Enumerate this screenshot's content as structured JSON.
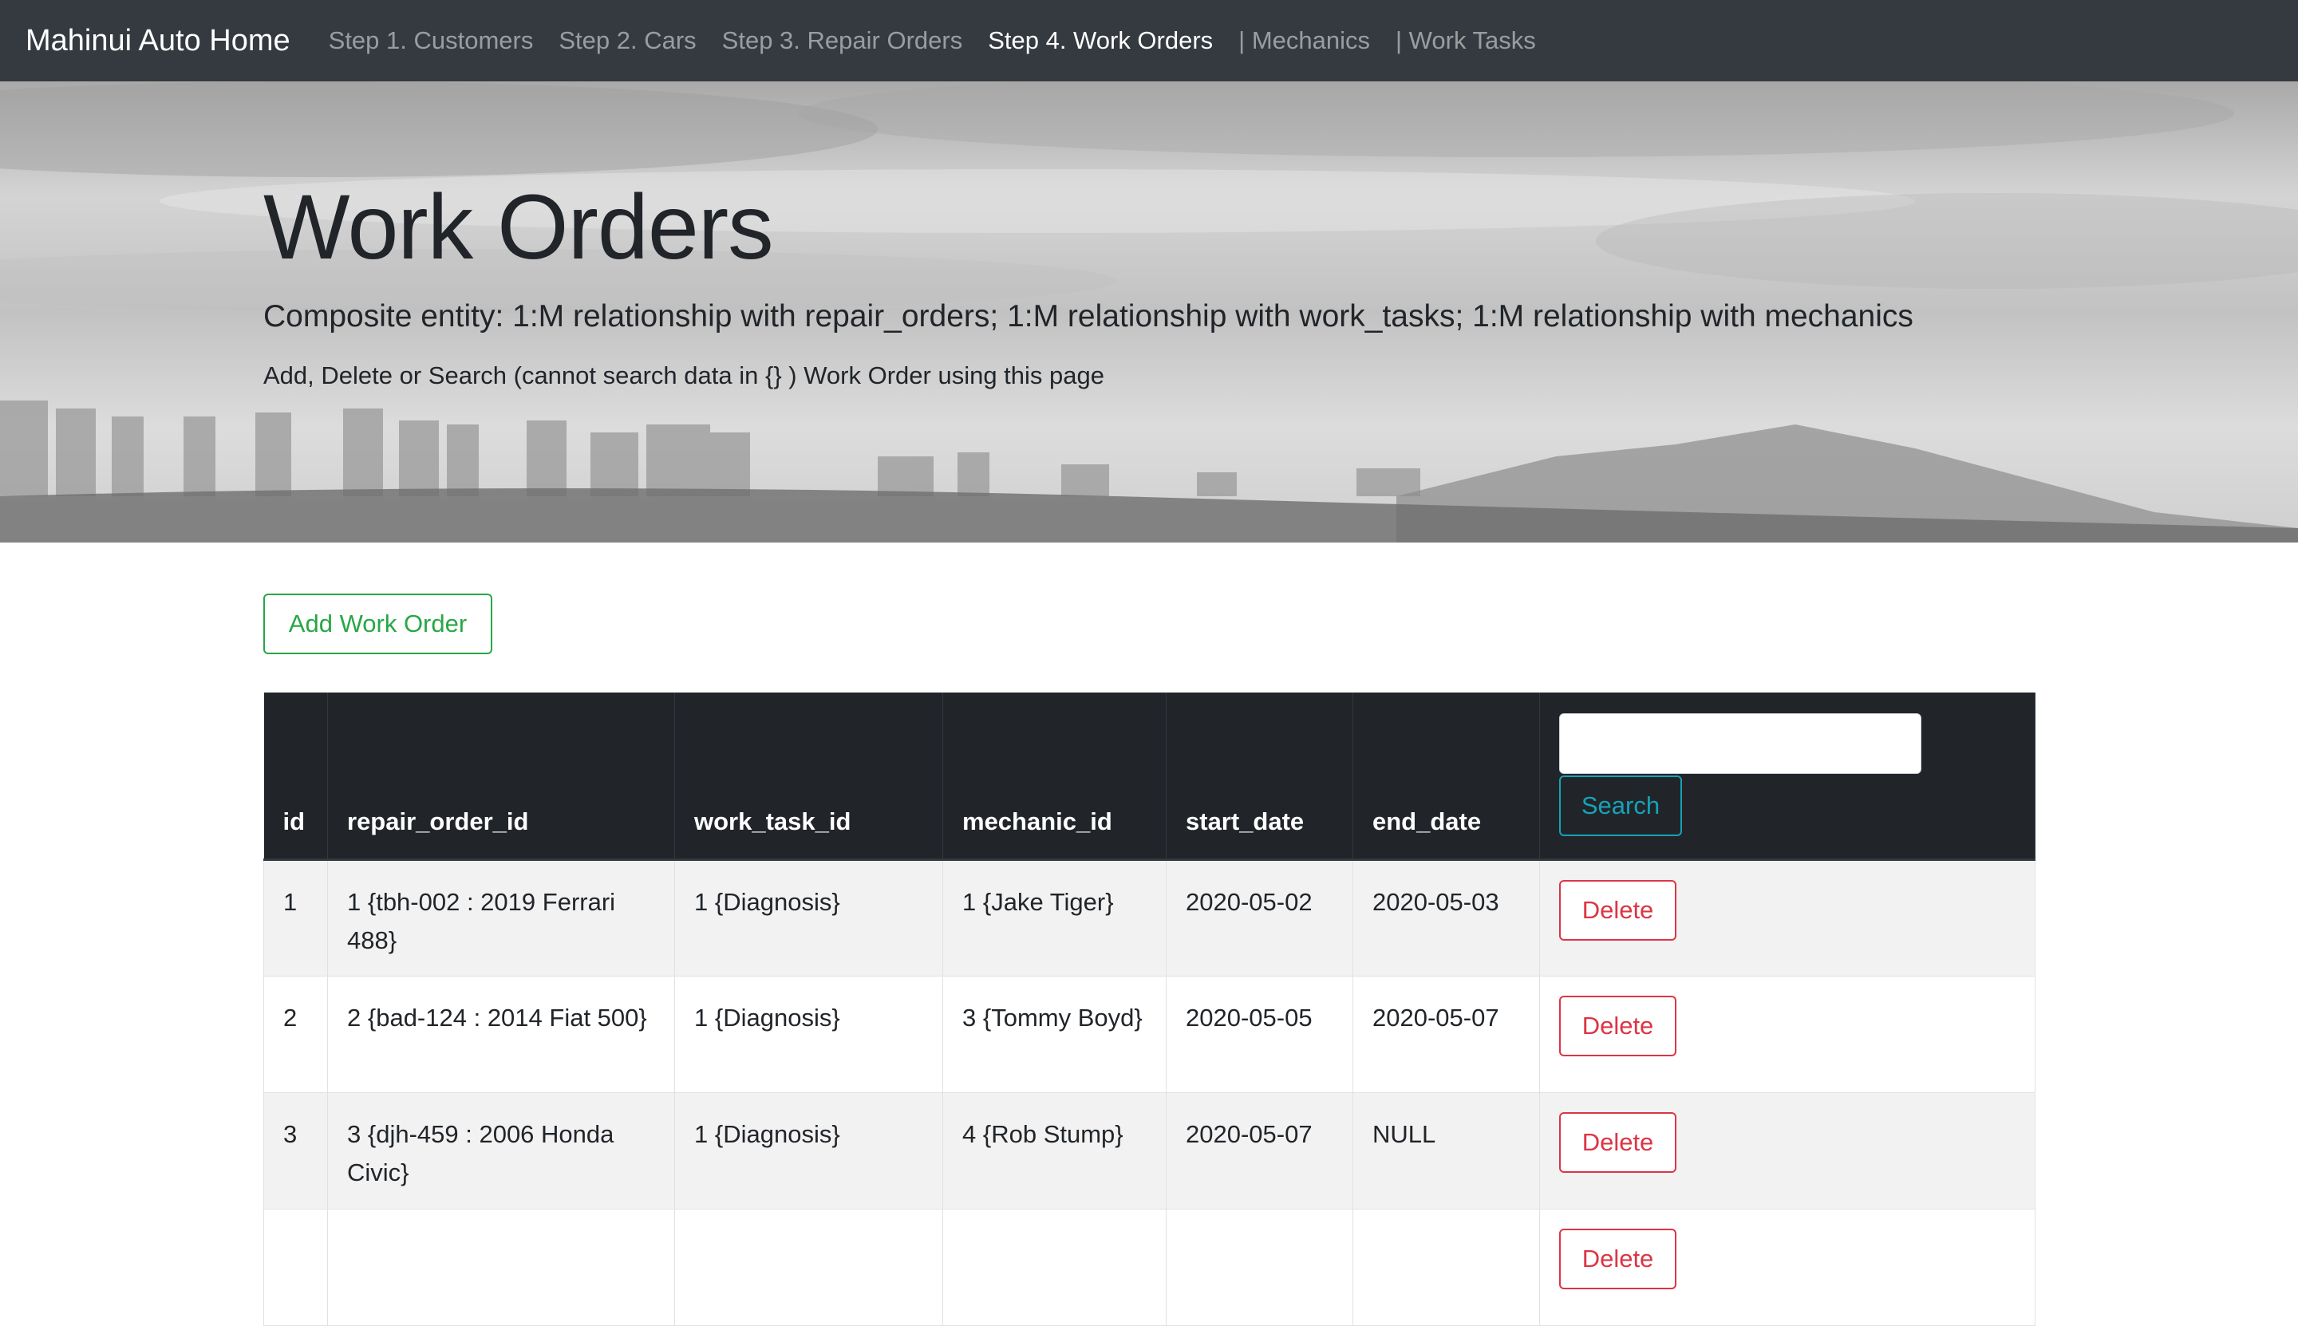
{
  "nav": {
    "brand": "Mahinui Auto Home",
    "links": [
      {
        "label": "Step 1. Customers",
        "active": false
      },
      {
        "label": "Step 2. Cars",
        "active": false
      },
      {
        "label": "Step 3. Repair Orders",
        "active": false
      },
      {
        "label": "Step 4. Work Orders",
        "active": true
      },
      {
        "label": "| Mechanics",
        "active": false
      },
      {
        "label": "| Work Tasks",
        "active": false
      }
    ]
  },
  "hero": {
    "title": "Work Orders",
    "lead": "Composite entity: 1:M relationship with repair_orders; 1:M relationship with work_tasks; 1:M relationship with mechanics",
    "subtitle": "Add, Delete or Search (cannot search data in {} ) Work Order using this page"
  },
  "actions": {
    "add_label": "Add Work Order",
    "search_label": "Search",
    "search_value": "",
    "delete_label": "Delete"
  },
  "table": {
    "columns": [
      "id",
      "repair_order_id",
      "work_task_id",
      "mechanic_id",
      "start_date",
      "end_date"
    ],
    "rows": [
      [
        "1",
        "1 {tbh-002 : 2019 Ferrari 488}",
        "1 {Diagnosis}",
        "1 {Jake Tiger}",
        "2020-05-02",
        "2020-05-03"
      ],
      [
        "2",
        "2 {bad-124 : 2014 Fiat 500}",
        "1 {Diagnosis}",
        "3 {Tommy Boyd}",
        "2020-05-05",
        "2020-05-07"
      ],
      [
        "3",
        "3 {djh-459 : 2006 Honda Civic}",
        "1 {Diagnosis}",
        "4 {Rob Stump}",
        "2020-05-07",
        "NULL"
      ]
    ]
  },
  "colors": {
    "navbar": "#343a40",
    "table_head": "#212529",
    "success": "#28a745",
    "info": "#17a2b8",
    "danger": "#dc3545"
  }
}
